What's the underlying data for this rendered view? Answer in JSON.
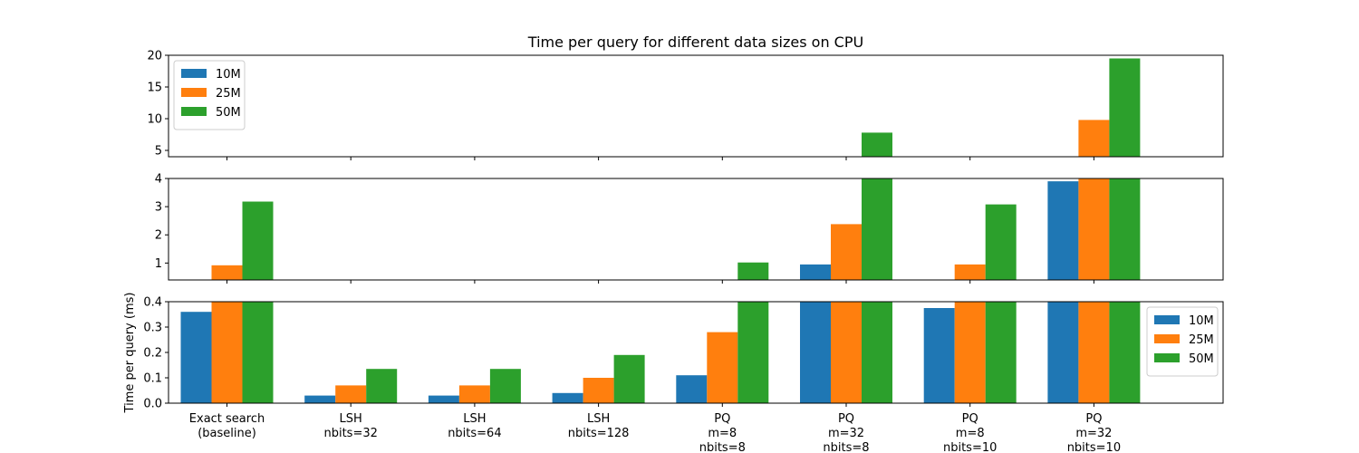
{
  "chart_data": {
    "type": "bar",
    "title": "Time per query for different data sizes on CPU",
    "ylabel": "Time per query (ms)",
    "xlabel": "",
    "categories": [
      [
        "Exact search",
        "(baseline)"
      ],
      [
        "LSH",
        "nbits=32"
      ],
      [
        "LSH",
        "nbits=64"
      ],
      [
        "LSH",
        "nbits=128"
      ],
      [
        "PQ",
        "m=8",
        "nbits=8"
      ],
      [
        "PQ",
        "m=32",
        "nbits=8"
      ],
      [
        "PQ",
        "m=8",
        "nbits=10"
      ],
      [
        "PQ",
        "m=32",
        "nbits=10"
      ]
    ],
    "series": [
      {
        "name": "10M",
        "color": "#1f77b4",
        "values": [
          0.36,
          0.03,
          0.03,
          0.04,
          0.11,
          0.95,
          0.375,
          3.9
        ]
      },
      {
        "name": "25M",
        "color": "#ff7f0e",
        "values": [
          0.92,
          0.07,
          0.07,
          0.1,
          0.28,
          2.38,
          0.95,
          9.8
        ]
      },
      {
        "name": "50M",
        "color": "#2ca02c",
        "values": [
          3.18,
          0.135,
          0.135,
          0.19,
          1.02,
          7.8,
          3.08,
          19.5
        ]
      }
    ],
    "panels": [
      {
        "ylim": [
          4,
          20
        ],
        "yticks": [
          5,
          10,
          15,
          20
        ],
        "tick_labels": [
          "5",
          "10",
          "15",
          "20"
        ],
        "legend": "top-left"
      },
      {
        "ylim": [
          0.4,
          4
        ],
        "yticks": [
          1,
          2,
          3,
          4
        ],
        "tick_labels": [
          "1",
          "2",
          "3",
          "4"
        ],
        "legend": "none"
      },
      {
        "ylim": [
          0,
          0.4
        ],
        "yticks": [
          0,
          0.1,
          0.2,
          0.3,
          0.4
        ],
        "tick_labels": [
          "0.0",
          "0.1",
          "0.2",
          "0.3",
          "0.4"
        ],
        "legend": "right"
      }
    ]
  }
}
